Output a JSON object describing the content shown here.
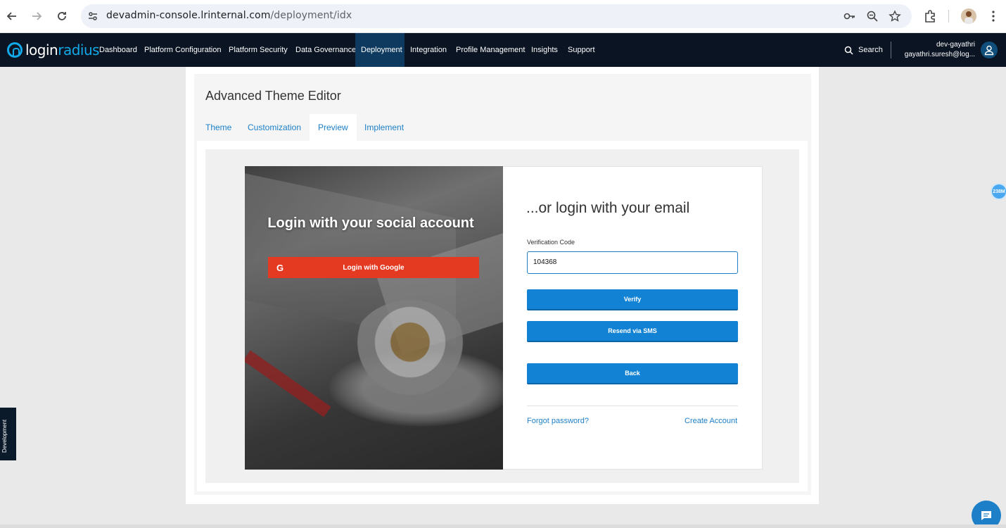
{
  "browser": {
    "url_host": "devadmin-console.lrinternal.com",
    "url_path": "/deployment/idx",
    "icons": [
      "back-icon",
      "forward-icon",
      "reload-icon",
      "site-settings-icon",
      "key-icon",
      "zoom-icon",
      "bookmark-star-icon",
      "extensions-icon",
      "profile-avatar",
      "menu-kebab-icon"
    ]
  },
  "appnav": {
    "logo_left": "login",
    "logo_right": "radius",
    "items": [
      "Dashboard",
      "Platform Configuration",
      "Platform Security",
      "Data Governance",
      "Deployment",
      "Integration",
      "Profile Management",
      "Insights",
      "Support"
    ],
    "active_item": "Deployment",
    "search_label": "Search",
    "user_name": "dev-gayathri",
    "user_email": "gayathri.suresh@log..."
  },
  "editor": {
    "title": "Advanced Theme Editor",
    "tabs": [
      "Theme",
      "Customization",
      "Preview",
      "Implement"
    ],
    "active_tab": "Preview"
  },
  "preview": {
    "social_title": "Login with your social account",
    "google_button": "Login with Google",
    "email_title": "...or login with your email",
    "verification_label": "Verification Code",
    "verification_value": "104368",
    "verify_button": "Verify",
    "resend_button": "Resend via SMS",
    "back_button": "Back",
    "forgot_link": "Forgot password?",
    "create_link": "Create Account"
  },
  "side_tab": "Development",
  "float_badge": "238M",
  "colors": {
    "nav_bg": "#0b1422",
    "nav_active": "#0d3a5e",
    "accent_blue": "#1283d4",
    "google_red": "#e53a22",
    "link_blue": "#1c7fc7"
  }
}
